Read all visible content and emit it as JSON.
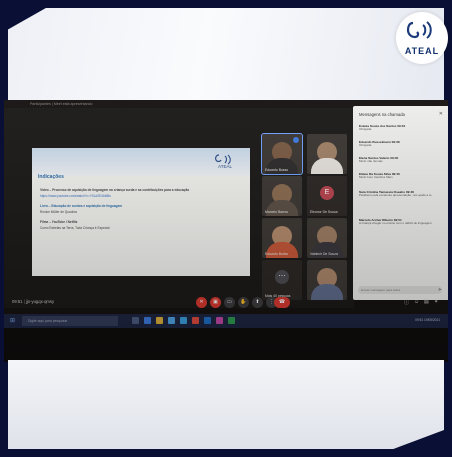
{
  "brand": {
    "name": "ATEAL",
    "accent": "#1a3a7a"
  },
  "meeting": {
    "window_title": "Participantes | Meet está apresentando",
    "time": "09:51",
    "meeting_code": "jjn-yugqx-qmsy",
    "controls": [
      "mic-off-icon",
      "camera-off-icon",
      "captions-icon",
      "raise-hand-icon",
      "present-icon",
      "more-icon",
      "leave-call-icon"
    ]
  },
  "slide": {
    "logo_text": "ATEAL",
    "title": "Indicações",
    "lines": [
      "Vídeo – Processo de aquisição de linguagem na criança surda e as contribuições para a educação",
      "https://www.youtube.com/watch?v=Y0Ld2E4bM8s",
      "Livro – Educação de surdos e aquisição de linguagem",
      "Ronice Müller de Quadros",
      "Filme – YouTube / Netflix",
      "Como Estrelas na Terra, Toda Criança é Especial"
    ]
  },
  "participants": [
    {
      "name": "Eduardo Busso",
      "type": "video",
      "highlight": true
    },
    {
      "name": "",
      "type": "video",
      "highlight": false
    },
    {
      "name": "Marcelo Barros",
      "type": "video",
      "highlight": false
    },
    {
      "name": "Eleonor De Souza",
      "type": "avatar",
      "initial": "E",
      "highlight": false
    },
    {
      "name": "Eduardo Borba",
      "type": "video",
      "highlight": false
    },
    {
      "name": "Valdecir De Souza",
      "type": "video",
      "highlight": false
    },
    {
      "name": "Mais 40 pessoas",
      "type": "more",
      "highlight": false
    },
    {
      "name": "",
      "type": "video",
      "highlight": false
    }
  ],
  "chat": {
    "title": "Mensagens na chamada",
    "messages": [
      {
        "name": "Evania Souza dos Santos  09:34",
        "text": "Obrigada"
      },
      {
        "name": "Eduardo Busselmann  09:38",
        "text": "Obrigada"
      },
      {
        "name": "Elena Santos Valerio  09:40",
        "text": "Muito não demais"
      },
      {
        "name": "Eliane Da Souza Silva  09:46",
        "text": "Muito bom Carolina Slam"
      },
      {
        "name": "Sara Cristina Tamassia Oseaho  09:48",
        "text": "Parabéns pela excelente apresentação, nos ajuda a te"
      },
      {
        "name": "Marcelo Archer Ribeiro  09:51",
        "text": "A criança chegar no ensino com o déficit de linguagem"
      }
    ],
    "input_placeholder": "Enviar mensagem para todos"
  },
  "taskbar": {
    "search_placeholder": "Digite aqui para pesquisar",
    "time": "09:51",
    "date": "19/05/2021"
  }
}
